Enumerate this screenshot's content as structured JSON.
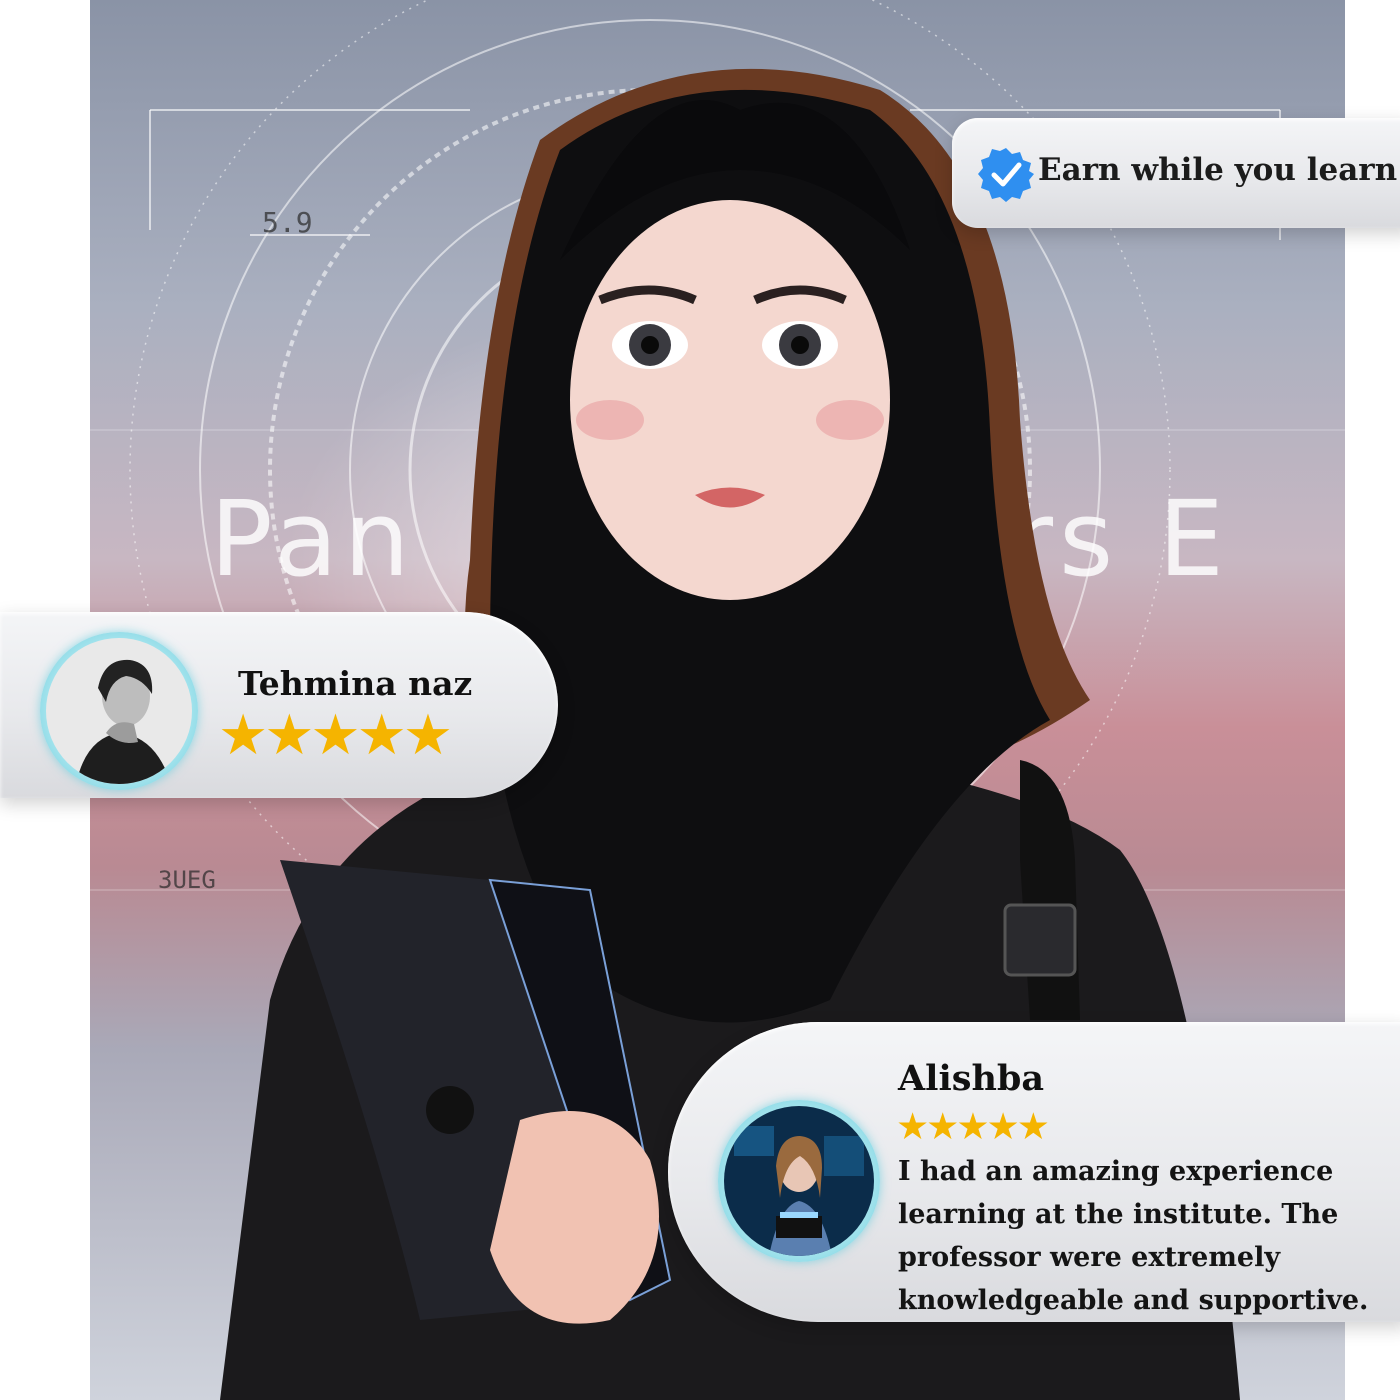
{
  "hero": {
    "background_word_left": "Pan",
    "background_word_right": "rs E",
    "background_code_top": "5.9",
    "background_code_side": "3UEG"
  },
  "earn_badge": {
    "icon": "check-badge-icon",
    "text": "Earn while you  learn",
    "accent": "#2f8ff0"
  },
  "testimonials": [
    {
      "name": "Tehmina naz",
      "rating": 5,
      "stars": "★★★★★",
      "avatar": "woman-portrait-avatar"
    },
    {
      "name": "Alishba",
      "rating": 5,
      "stars": "★★★★★",
      "avatar": "girl-with-laptop-avatar",
      "review_lines": [
        "I had an amazing experience",
        "learning at the institute. The",
        "professor were extremely",
        "knowledgeable and supportive."
      ]
    }
  ],
  "colors": {
    "star": "#f5b400",
    "avatar_ring": "#66c8d8"
  }
}
